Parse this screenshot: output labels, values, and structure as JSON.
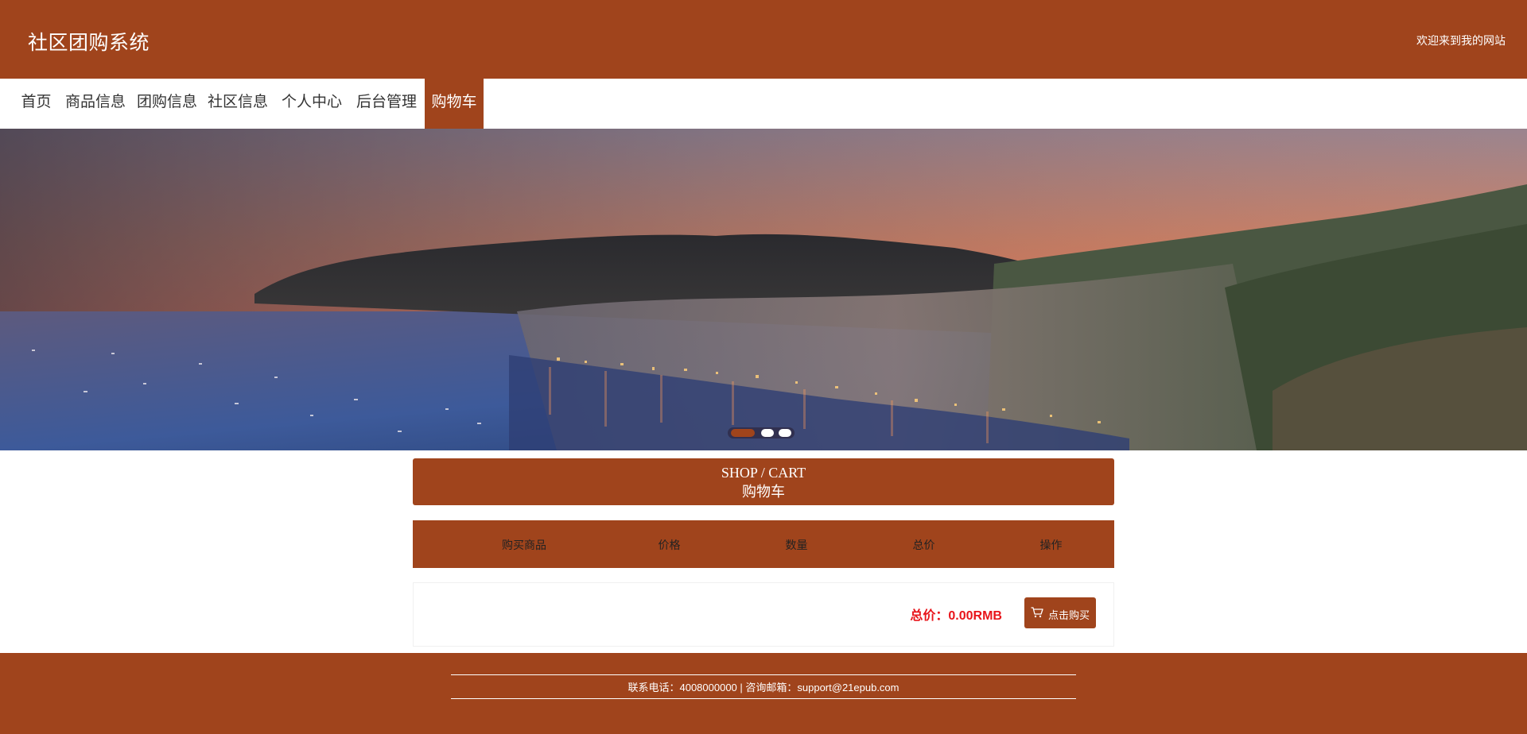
{
  "header": {
    "site_title": "社区团购系统",
    "welcome": "欢迎来到我的网站"
  },
  "nav": {
    "items": [
      {
        "label": "首页"
      },
      {
        "label": "商品信息"
      },
      {
        "label": "团购信息"
      },
      {
        "label": "社区信息"
      },
      {
        "label": "个人中心"
      },
      {
        "label": "后台管理"
      },
      {
        "label": "购物车"
      }
    ],
    "active_index": 6
  },
  "carousel": {
    "slide_count": 3,
    "active_slide": 1
  },
  "cart_banner": {
    "title_en": "SHOP / CART",
    "title_cn": "购物车"
  },
  "cart_table": {
    "columns": [
      "购买商品",
      "价格",
      "数量",
      "总价",
      "操作"
    ],
    "rows": []
  },
  "summary": {
    "total_label": "总价：0.00RMB",
    "buy_button": "点击购买",
    "buy_icon": "shopping-cart-icon"
  },
  "footer": {
    "contact": "联系电话：4008000000 | 咨询邮箱：support@21epub.com"
  },
  "colors": {
    "brand": "#a0441c",
    "total_text": "#e8141a"
  }
}
